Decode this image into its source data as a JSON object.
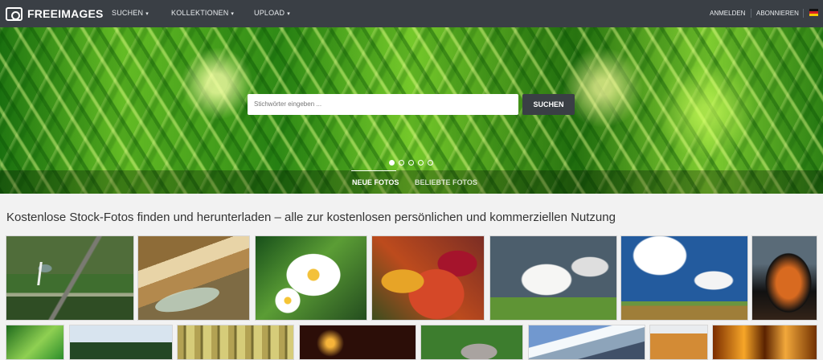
{
  "header": {
    "brand": "FREEIMAGES",
    "nav": [
      {
        "label": "SUCHEN"
      },
      {
        "label": "KOLLEKTIONEN"
      },
      {
        "label": "UPLOAD"
      }
    ],
    "login_label": "ANMELDEN",
    "subscribe_label": "ABONNIEREN",
    "language_icon": "german-flag-icon"
  },
  "hero": {
    "search_placeholder": "Stichwörter eingeben ...",
    "search_button_label": "SUCHEN",
    "slide_count": 5,
    "active_slide": 1,
    "tabs": [
      "NEUE FOTOS",
      "BELIEBTE FOTOS"
    ],
    "active_tab": "NEUE FOTOS"
  },
  "main": {
    "headline": "Kostenlose Stock-Fotos finden und herunterladen – alle zur kostenlosen persönlichen und kommerziellen Nutzung"
  },
  "colors": {
    "topbar": "#3a3f45",
    "hero_green": "#5bb329",
    "search_button": "#3a3f45"
  }
}
